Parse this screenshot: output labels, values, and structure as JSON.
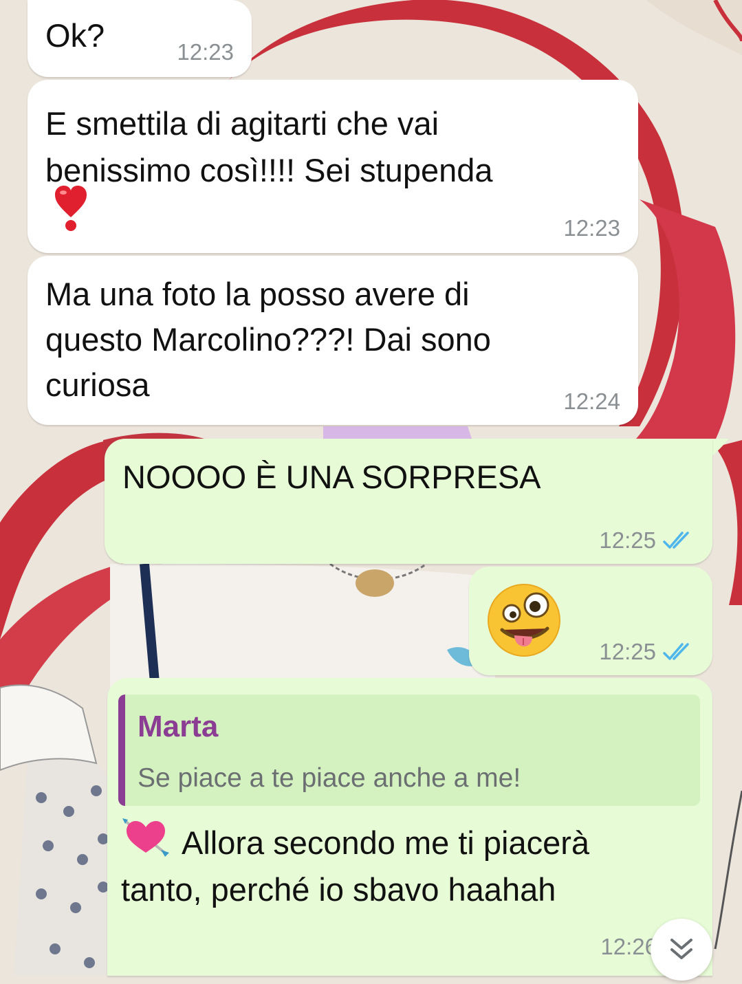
{
  "messages": [
    {
      "id": "m1",
      "direction": "incoming",
      "text": "Ok?",
      "time": "12:23"
    },
    {
      "id": "m2",
      "direction": "incoming",
      "lines": [
        "E smettila di agitarti che vai",
        "benissimo così!!!! Sei stupenda"
      ],
      "emoji": "heart-exclamation-icon",
      "time": "12:23"
    },
    {
      "id": "m3",
      "direction": "incoming",
      "lines": [
        "Ma una foto la posso avere di",
        "questo Marcolino???! Dai sono",
        "curiosa"
      ],
      "time": "12:24"
    },
    {
      "id": "m4",
      "direction": "outgoing",
      "text": "NOOOO È UNA SORPRESA",
      "time": "12:25",
      "status": "read"
    },
    {
      "id": "m5",
      "direction": "outgoing",
      "emoji": "zany-face-icon",
      "time": "12:25",
      "status": "read"
    },
    {
      "id": "m6",
      "direction": "outgoing",
      "quote": {
        "author": "Marta",
        "text": "Se piace a te piace anche a me!"
      },
      "emoji": "heart-with-arrow-icon",
      "lines": [
        "Allora secondo me ti piacerà",
        "tanto, perché io sbavo haahah"
      ],
      "time": "12:26",
      "status": "read"
    }
  ],
  "colors": {
    "incoming_bubble": "#ffffff",
    "outgoing_bubble": "#e7fcd6",
    "quote_accent": "#8b3d93",
    "read_ticks": "#4fb6ec",
    "timestamp": "#8a8f93"
  },
  "scroll_button": {
    "icon": "double-chevron-down-icon"
  }
}
